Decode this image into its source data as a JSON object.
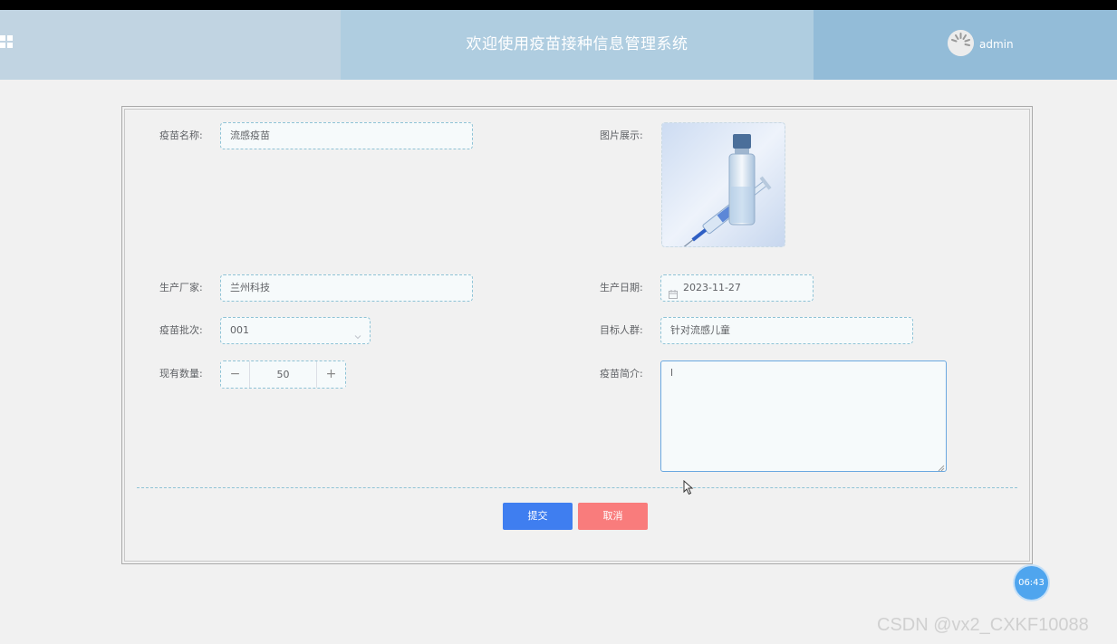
{
  "header": {
    "title": "欢迎使用疫苗接种信息管理系统",
    "username": "admin"
  },
  "form": {
    "vaccine_name": {
      "label": "疫苗名称:",
      "value": "流感疫苗"
    },
    "image": {
      "label": "图片展示:"
    },
    "manufacturer": {
      "label": "生产厂家:",
      "value": "兰州科技"
    },
    "production_date": {
      "label": "生产日期:",
      "value": "2023-11-27"
    },
    "batch": {
      "label": "疫苗批次:",
      "value": "001"
    },
    "target_group": {
      "label": "目标人群:",
      "value": "针对流感儿童"
    },
    "quantity": {
      "label": "现有数量:",
      "value": "50",
      "minus": "−",
      "plus": "+"
    },
    "description": {
      "label": "疫苗简介:",
      "value": "l"
    }
  },
  "buttons": {
    "submit": "提交",
    "cancel": "取消"
  },
  "time_badge": "06:43",
  "watermark": "CSDN @vx2_CXKF10088",
  "colors": {
    "header_left": "#c1d4e2",
    "header_center": "#afcde0",
    "header_right": "#93bcd8",
    "submit": "#3f7ef0",
    "cancel": "#f97c7c",
    "input_border": "#8fc3d6"
  }
}
